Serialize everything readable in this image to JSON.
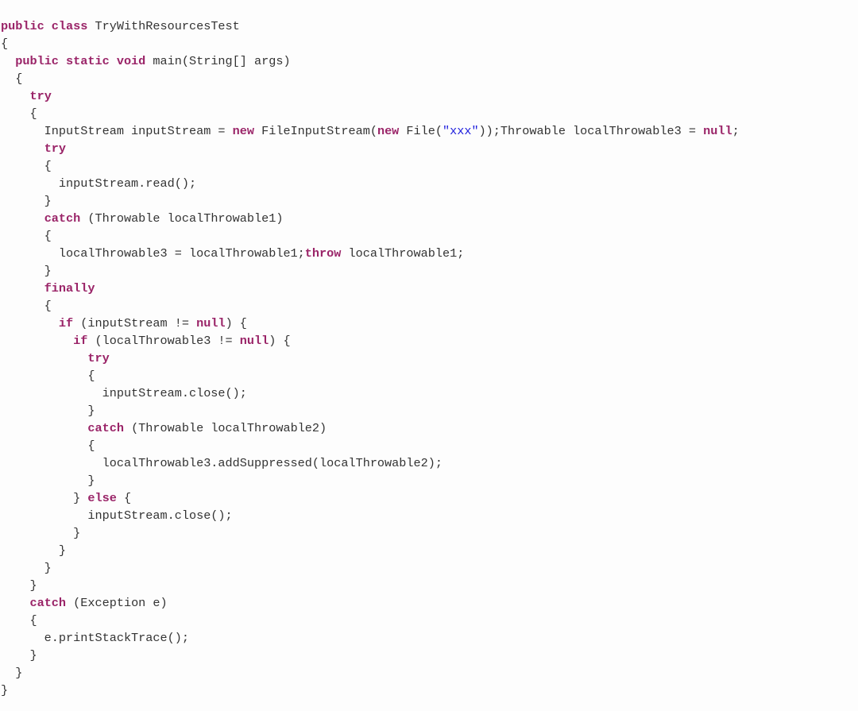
{
  "document": {
    "kind": "code-listing",
    "language": "Java",
    "class_name": "TryWithResourcesTest",
    "colors": {
      "background": "#fdfdfd",
      "plain_text": "#333333",
      "keyword": "#9a2468",
      "string": "#2222dd"
    },
    "full_text": "public class TryWithResourcesTest\n{\n  public static void main(String[] args)\n  {\n    try\n    {\n      InputStream inputStream = new FileInputStream(new File(\"xxx\"));Throwable localThrowable3 = null;\n      try\n      {\n        inputStream.read();\n      }\n      catch (Throwable localThrowable1)\n      {\n        localThrowable3 = localThrowable1;throw localThrowable1;\n      }\n      finally\n      {\n        if (inputStream != null) {\n          if (localThrowable3 != null) {\n            try\n            {\n              inputStream.close();\n            }\n            catch (Throwable localThrowable2)\n            {\n              localThrowable3.addSuppressed(localThrowable2);\n            }\n          } else {\n            inputStream.close();\n          }\n        }\n      }\n    }\n    catch (Exception e)\n    {\n      e.printStackTrace();\n    }\n  }\n}",
    "lines": [
      {
        "n": 1,
        "tokens": [
          {
            "t": "kw",
            "v": "public class"
          },
          {
            "t": "pl",
            "v": " TryWithResourcesTest"
          }
        ]
      },
      {
        "n": 2,
        "tokens": [
          {
            "t": "pl",
            "v": "{"
          }
        ]
      },
      {
        "n": 3,
        "tokens": [
          {
            "t": "pl",
            "v": "  "
          },
          {
            "t": "kw",
            "v": "public static void"
          },
          {
            "t": "pl",
            "v": " main(String[] args)"
          }
        ]
      },
      {
        "n": 4,
        "tokens": [
          {
            "t": "pl",
            "v": "  {"
          }
        ]
      },
      {
        "n": 5,
        "tokens": [
          {
            "t": "pl",
            "v": "    "
          },
          {
            "t": "kw",
            "v": "try"
          }
        ]
      },
      {
        "n": 6,
        "tokens": [
          {
            "t": "pl",
            "v": "    {"
          }
        ]
      },
      {
        "n": 7,
        "tokens": [
          {
            "t": "pl",
            "v": "      InputStream inputStream = "
          },
          {
            "t": "kw",
            "v": "new"
          },
          {
            "t": "pl",
            "v": " FileInputStream("
          },
          {
            "t": "kw",
            "v": "new"
          },
          {
            "t": "pl",
            "v": " File("
          },
          {
            "t": "str",
            "v": "\"xxx\""
          },
          {
            "t": "pl",
            "v": "));Throwable localThrowable3 = "
          },
          {
            "t": "kw",
            "v": "null"
          },
          {
            "t": "pl",
            "v": ";"
          }
        ]
      },
      {
        "n": 8,
        "tokens": [
          {
            "t": "pl",
            "v": "      "
          },
          {
            "t": "kw",
            "v": "try"
          }
        ]
      },
      {
        "n": 9,
        "tokens": [
          {
            "t": "pl",
            "v": "      {"
          }
        ]
      },
      {
        "n": 10,
        "tokens": [
          {
            "t": "pl",
            "v": "        inputStream.read();"
          }
        ]
      },
      {
        "n": 11,
        "tokens": [
          {
            "t": "pl",
            "v": "      }"
          }
        ]
      },
      {
        "n": 12,
        "tokens": [
          {
            "t": "pl",
            "v": "      "
          },
          {
            "t": "kw",
            "v": "catch"
          },
          {
            "t": "pl",
            "v": " (Throwable localThrowable1)"
          }
        ]
      },
      {
        "n": 13,
        "tokens": [
          {
            "t": "pl",
            "v": "      {"
          }
        ]
      },
      {
        "n": 14,
        "tokens": [
          {
            "t": "pl",
            "v": "        localThrowable3 = localThrowable1;"
          },
          {
            "t": "kw",
            "v": "throw"
          },
          {
            "t": "pl",
            "v": " localThrowable1;"
          }
        ]
      },
      {
        "n": 15,
        "tokens": [
          {
            "t": "pl",
            "v": "      }"
          }
        ]
      },
      {
        "n": 16,
        "tokens": [
          {
            "t": "pl",
            "v": "      "
          },
          {
            "t": "kw",
            "v": "finally"
          }
        ]
      },
      {
        "n": 17,
        "tokens": [
          {
            "t": "pl",
            "v": "      {"
          }
        ]
      },
      {
        "n": 18,
        "tokens": [
          {
            "t": "pl",
            "v": "        "
          },
          {
            "t": "kw",
            "v": "if"
          },
          {
            "t": "pl",
            "v": " (inputStream != "
          },
          {
            "t": "kw",
            "v": "null"
          },
          {
            "t": "pl",
            "v": ") {"
          }
        ]
      },
      {
        "n": 19,
        "tokens": [
          {
            "t": "pl",
            "v": "          "
          },
          {
            "t": "kw",
            "v": "if"
          },
          {
            "t": "pl",
            "v": " (localThrowable3 != "
          },
          {
            "t": "kw",
            "v": "null"
          },
          {
            "t": "pl",
            "v": ") {"
          }
        ]
      },
      {
        "n": 20,
        "tokens": [
          {
            "t": "pl",
            "v": "            "
          },
          {
            "t": "kw",
            "v": "try"
          }
        ]
      },
      {
        "n": 21,
        "tokens": [
          {
            "t": "pl",
            "v": "            {"
          }
        ]
      },
      {
        "n": 22,
        "tokens": [
          {
            "t": "pl",
            "v": "              inputStream.close();"
          }
        ]
      },
      {
        "n": 23,
        "tokens": [
          {
            "t": "pl",
            "v": "            }"
          }
        ]
      },
      {
        "n": 24,
        "tokens": [
          {
            "t": "pl",
            "v": "            "
          },
          {
            "t": "kw",
            "v": "catch"
          },
          {
            "t": "pl",
            "v": " (Throwable localThrowable2)"
          }
        ]
      },
      {
        "n": 25,
        "tokens": [
          {
            "t": "pl",
            "v": "            {"
          }
        ]
      },
      {
        "n": 26,
        "tokens": [
          {
            "t": "pl",
            "v": "              localThrowable3.addSuppressed(localThrowable2);"
          }
        ]
      },
      {
        "n": 27,
        "tokens": [
          {
            "t": "pl",
            "v": "            }"
          }
        ]
      },
      {
        "n": 28,
        "tokens": [
          {
            "t": "pl",
            "v": "          } "
          },
          {
            "t": "kw",
            "v": "else"
          },
          {
            "t": "pl",
            "v": " {"
          }
        ]
      },
      {
        "n": 29,
        "tokens": [
          {
            "t": "pl",
            "v": "            inputStream.close();"
          }
        ]
      },
      {
        "n": 30,
        "tokens": [
          {
            "t": "pl",
            "v": "          }"
          }
        ]
      },
      {
        "n": 31,
        "tokens": [
          {
            "t": "pl",
            "v": "        }"
          }
        ]
      },
      {
        "n": 32,
        "tokens": [
          {
            "t": "pl",
            "v": "      }"
          }
        ]
      },
      {
        "n": 33,
        "tokens": [
          {
            "t": "pl",
            "v": "    }"
          }
        ]
      },
      {
        "n": 34,
        "tokens": [
          {
            "t": "pl",
            "v": "    "
          },
          {
            "t": "kw",
            "v": "catch"
          },
          {
            "t": "pl",
            "v": " (Exception e)"
          }
        ]
      },
      {
        "n": 35,
        "tokens": [
          {
            "t": "pl",
            "v": "    {"
          }
        ]
      },
      {
        "n": 36,
        "tokens": [
          {
            "t": "pl",
            "v": "      e.printStackTrace();"
          }
        ]
      },
      {
        "n": 37,
        "tokens": [
          {
            "t": "pl",
            "v": "    }"
          }
        ]
      },
      {
        "n": 38,
        "tokens": [
          {
            "t": "pl",
            "v": "  }"
          }
        ]
      },
      {
        "n": 39,
        "tokens": [
          {
            "t": "pl",
            "v": "}"
          }
        ]
      }
    ]
  }
}
